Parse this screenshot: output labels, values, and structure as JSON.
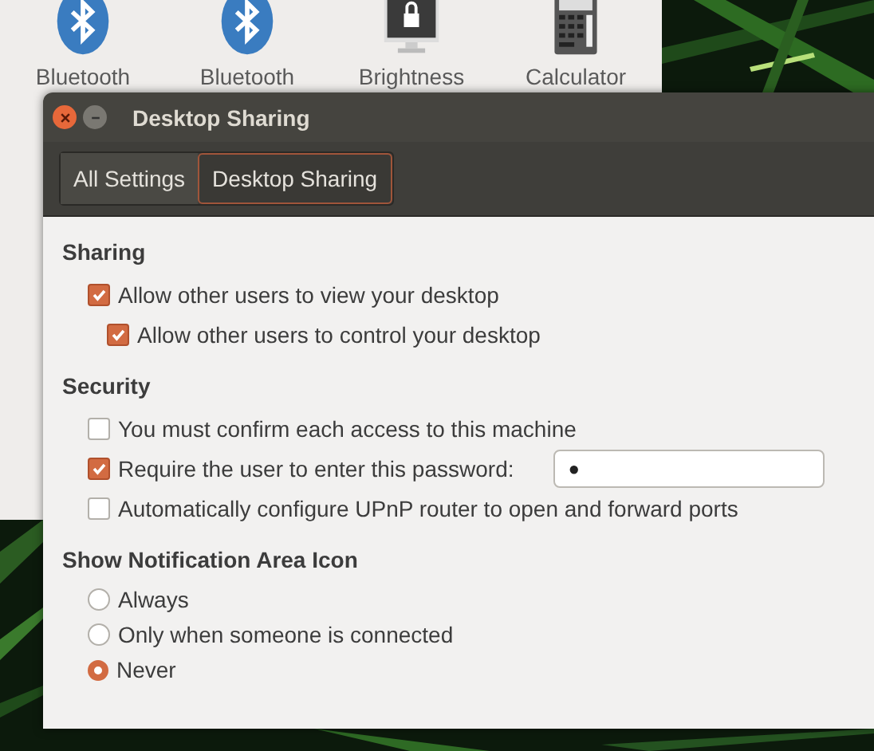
{
  "settings_window": {
    "items": [
      {
        "label": "Bluetooth",
        "kind": "bluetooth"
      },
      {
        "label": "Bluetooth",
        "kind": "bluetooth"
      },
      {
        "label": "Brightness",
        "kind": "brightness"
      },
      {
        "label": "Calculator",
        "kind": "calculator"
      }
    ]
  },
  "dialog": {
    "title": "Desktop Sharing",
    "breadcrumbs": [
      {
        "label": "All Settings",
        "selected": false
      },
      {
        "label": "Desktop Sharing",
        "selected": true
      }
    ],
    "sections": [
      {
        "title": "Sharing",
        "options": [
          {
            "kind": "checkbox",
            "label": "Allow other users to view your desktop",
            "checked": true,
            "children": [
              {
                "kind": "checkbox",
                "label": "Allow other users to control your desktop",
                "checked": true
              }
            ]
          }
        ]
      },
      {
        "title": "Security",
        "options": [
          {
            "kind": "checkbox",
            "label": "You must confirm each access to this machine",
            "checked": false
          },
          {
            "kind": "password",
            "label": "Require the user to enter this password:",
            "checked": true,
            "value": "●"
          },
          {
            "kind": "checkbox",
            "label": "Automatically configure UPnP router to open and forward ports",
            "checked": false
          }
        ]
      },
      {
        "title": "Show Notification Area Icon",
        "options": [
          {
            "kind": "radio",
            "label": "Always",
            "selected": false
          },
          {
            "kind": "radio",
            "label": "Only when someone is connected",
            "selected": false
          },
          {
            "kind": "radio",
            "label": "Never",
            "selected": true
          }
        ]
      }
    ]
  }
}
